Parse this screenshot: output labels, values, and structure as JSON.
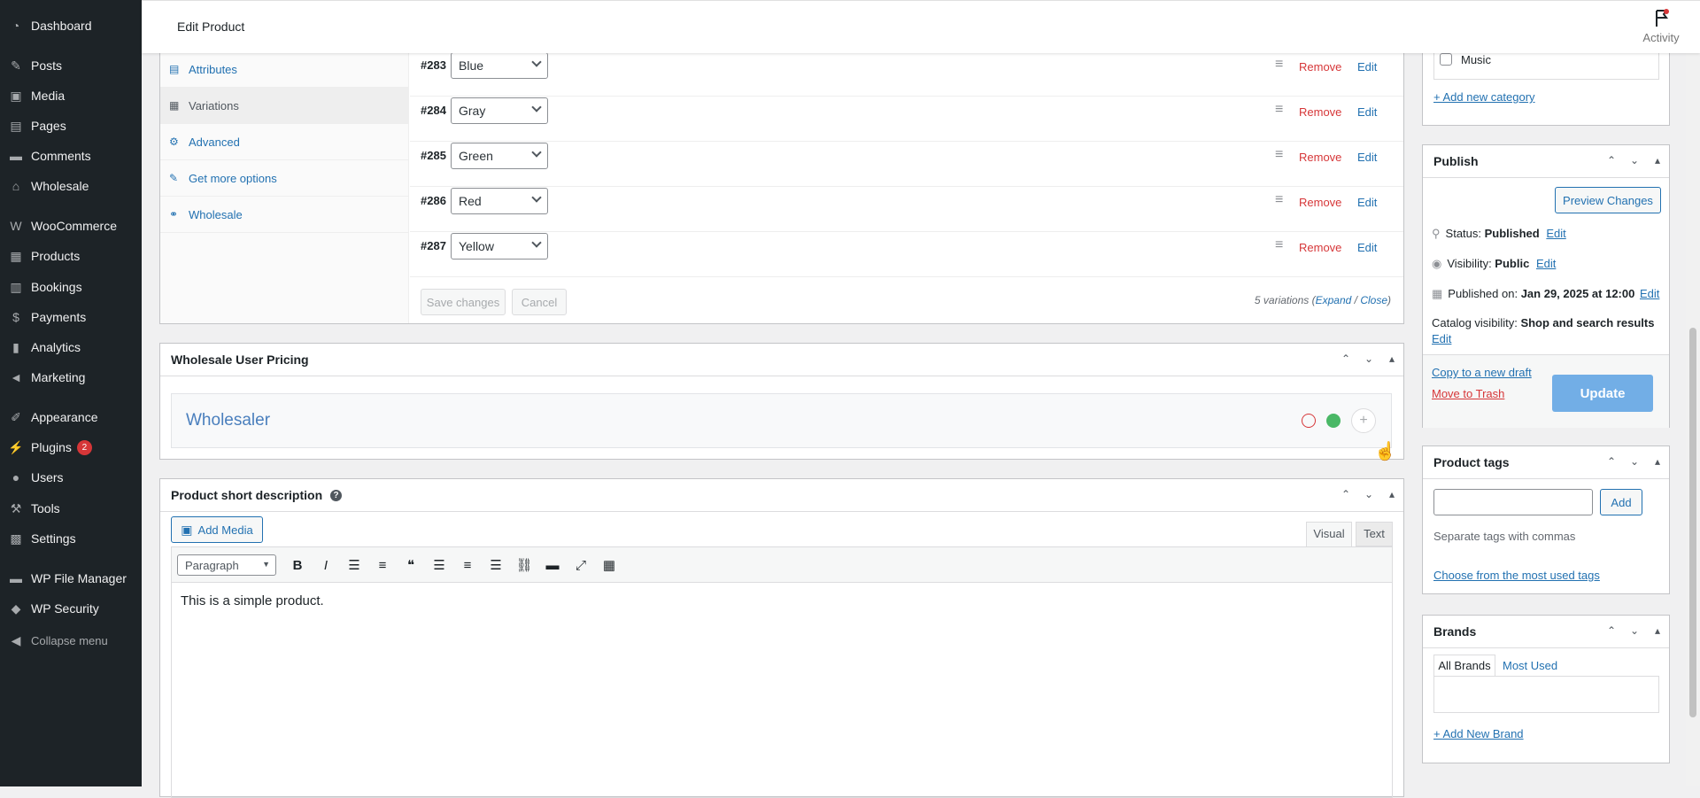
{
  "sidebar": {
    "items": [
      {
        "label": "Dashboard",
        "icon": "dashboard-icon",
        "glyph": "◔"
      },
      {
        "label": "Posts",
        "icon": "pushpin-icon",
        "glyph": "✎"
      },
      {
        "label": "Media",
        "icon": "media-icon",
        "glyph": "▣"
      },
      {
        "label": "Pages",
        "icon": "pages-icon",
        "glyph": "▤"
      },
      {
        "label": "Comments",
        "icon": "comments-icon",
        "glyph": "▬"
      },
      {
        "label": "Wholesale",
        "icon": "store-icon",
        "glyph": "⌂"
      },
      {
        "label": "WooCommerce",
        "icon": "woocommerce-icon",
        "glyph": "W"
      },
      {
        "label": "Products",
        "icon": "archive-icon",
        "glyph": "▦"
      },
      {
        "label": "Bookings",
        "icon": "calendar-icon",
        "glyph": "▥"
      },
      {
        "label": "Payments",
        "icon": "dollar-icon",
        "glyph": "$"
      },
      {
        "label": "Analytics",
        "icon": "bar-chart-icon",
        "glyph": "▮"
      },
      {
        "label": "Marketing",
        "icon": "megaphone-icon",
        "glyph": "◄"
      },
      {
        "label": "Appearance",
        "icon": "paintbrush-icon",
        "glyph": "✐"
      },
      {
        "label": "Plugins",
        "icon": "plugin-icon",
        "glyph": "⚡",
        "badge": "2"
      },
      {
        "label": "Users",
        "icon": "user-icon",
        "glyph": "●"
      },
      {
        "label": "Tools",
        "icon": "wrench-icon",
        "glyph": "⚒"
      },
      {
        "label": "Settings",
        "icon": "settings-icon",
        "glyph": "▩"
      },
      {
        "label": "WP File Manager",
        "icon": "folder-icon",
        "glyph": "▬"
      },
      {
        "label": "WP Security",
        "icon": "shield-icon",
        "glyph": "◆"
      }
    ],
    "collapse_label": "Collapse menu"
  },
  "header": {
    "title": "Edit Product",
    "activity_label": "Activity"
  },
  "product_data": {
    "tabs": [
      "Attributes",
      "Variations",
      "Advanced",
      "Get more options",
      "Wholesale"
    ],
    "variations": [
      {
        "id": "#283",
        "value": "Blue"
      },
      {
        "id": "#284",
        "value": "Gray"
      },
      {
        "id": "#285",
        "value": "Green"
      },
      {
        "id": "#286",
        "value": "Red"
      },
      {
        "id": "#287",
        "value": "Yellow"
      }
    ],
    "remove_label": "Remove",
    "edit_label": "Edit",
    "save_label": "Save changes",
    "cancel_label": "Cancel",
    "count_text": "5 variations (",
    "expand_label": "Expand",
    "sep": " / ",
    "close_label": "Close",
    "close_paren": ")"
  },
  "wholesale_pricing": {
    "title": "Wholesale User Pricing",
    "role": "Wholesaler"
  },
  "short_description": {
    "title": "Product short description",
    "add_media": "Add Media",
    "tab_visual": "Visual",
    "tab_text": "Text",
    "format": "Paragraph",
    "content": "This is a simple product."
  },
  "categories": {
    "last_item": "Music",
    "add_new": "+ Add new category"
  },
  "publish": {
    "title": "Publish",
    "preview_label": "Preview Changes",
    "status_label": "Status: ",
    "status_value": "Published",
    "visibility_label": "Visibility: ",
    "visibility_value": "Public",
    "published_label": "Published on: ",
    "published_value": "Jan 29, 2025 at 12:00",
    "catalog_label": "Catalog visibility: ",
    "catalog_value": "Shop and search results",
    "edit_label": "Edit",
    "copy_draft": "Copy to a new draft",
    "trash": "Move to Trash",
    "update": "Update"
  },
  "tags": {
    "title": "Product tags",
    "add_label": "Add",
    "hint": "Separate tags with commas",
    "choose": "Choose from the most used tags"
  },
  "brands": {
    "title": "Brands",
    "tab_all": "All Brands",
    "tab_most": "Most Used",
    "add_new": "+ Add New Brand"
  },
  "colors": {
    "accent": "#2271b1",
    "sidebar_bg": "#1d2327",
    "danger": "#d63638",
    "update_btn": "#72aee6"
  }
}
